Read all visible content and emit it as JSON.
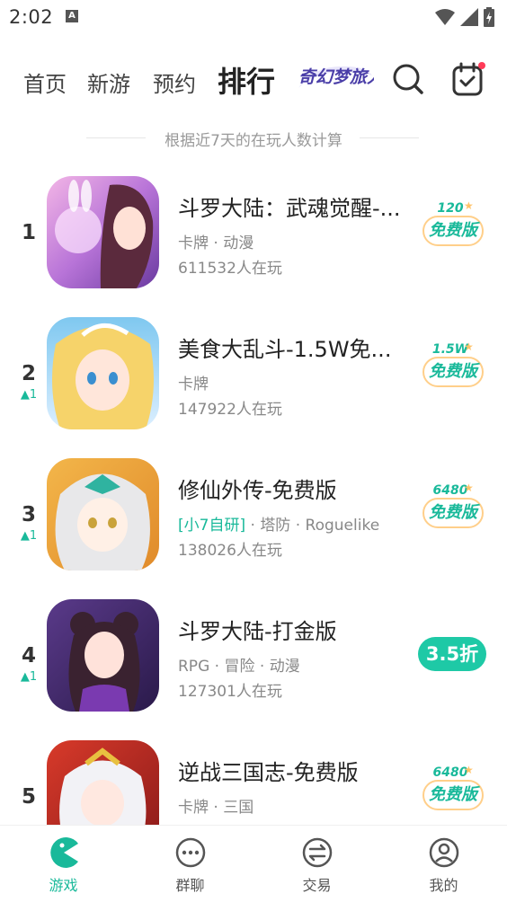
{
  "status_bar": {
    "time": "2:02",
    "notification_icon": "A"
  },
  "nav": {
    "tabs": [
      {
        "label": "首页"
      },
      {
        "label": "新游"
      },
      {
        "label": "预约"
      },
      {
        "label": "排行"
      }
    ],
    "active_tab": "排行",
    "brand_logo_text": "奇幻梦旅人",
    "icons": [
      "search-icon",
      "calendar-check-icon"
    ]
  },
  "subtitle": "根据近7天的在玩人数计算",
  "games": [
    {
      "rank": "1",
      "change": "",
      "title": "斗罗大陆：武魂觉醒-...",
      "tags": [
        {
          "text": "卡牌",
          "highlight": false
        },
        {
          "text": "动漫",
          "highlight": false
        }
      ],
      "players": "611532人在玩",
      "badge": {
        "type": "free",
        "amount": "120",
        "label": "免费版"
      }
    },
    {
      "rank": "2",
      "change": "▲1",
      "title": "美食大乱斗-1.5W免...",
      "tags": [
        {
          "text": "卡牌",
          "highlight": false
        }
      ],
      "players": "147922人在玩",
      "badge": {
        "type": "free",
        "amount": "1.5W",
        "label": "免费版"
      }
    },
    {
      "rank": "3",
      "change": "▲1",
      "title": "修仙外传-免费版",
      "tags": [
        {
          "text": "[小7自研]",
          "highlight": true
        },
        {
          "text": "塔防",
          "highlight": false
        },
        {
          "text": "Roguelike",
          "highlight": false
        }
      ],
      "players": "138026人在玩",
      "badge": {
        "type": "free",
        "amount": "6480",
        "label": "免费版"
      }
    },
    {
      "rank": "4",
      "change": "▲1",
      "title": "斗罗大陆-打金版",
      "tags": [
        {
          "text": "RPG",
          "highlight": false
        },
        {
          "text": "冒险",
          "highlight": false
        },
        {
          "text": "动漫",
          "highlight": false
        }
      ],
      "players": "127301人在玩",
      "badge": {
        "type": "discount",
        "label": "3.5折"
      }
    },
    {
      "rank": "5",
      "change": "",
      "title": "逆战三国志-免费版",
      "tags": [
        {
          "text": "卡牌",
          "highlight": false
        },
        {
          "text": "三国",
          "highlight": false
        }
      ],
      "players": "",
      "badge": {
        "type": "free",
        "amount": "6480",
        "label": "免费版"
      }
    }
  ],
  "bottom_nav": {
    "items": [
      {
        "label": "游戏",
        "icon": "game-pacman-icon",
        "active": true
      },
      {
        "label": "群聊",
        "icon": "chat-bubble-icon",
        "active": false
      },
      {
        "label": "交易",
        "icon": "trade-exchange-icon",
        "active": false
      },
      {
        "label": "我的",
        "icon": "profile-icon",
        "active": false
      }
    ]
  },
  "colors": {
    "accent": "#19b99a",
    "badge_border": "#ffcf8a",
    "discount_bg": "#1ec9a6"
  }
}
